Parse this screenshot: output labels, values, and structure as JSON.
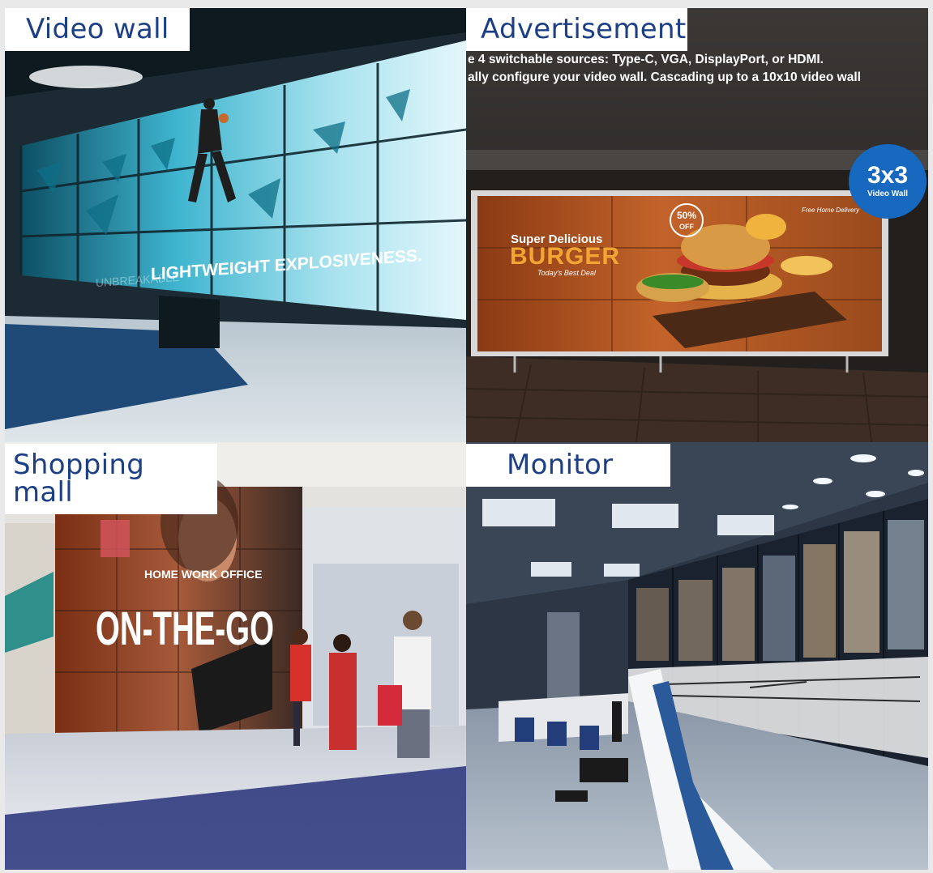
{
  "panels": {
    "video_wall": {
      "title": "Video wall",
      "wall_text": "LIGHTWEIGHT EXPLOSIVENESS.",
      "wall_text_faded": "UNBREAKABLE"
    },
    "advertisement": {
      "title": "Advertisement",
      "caption_line1": "e 4 switchable sources: Type-C, VGA, DisplayPort, or HDMI.",
      "caption_line2": "ally configure your video wall. Cascading up to a 10x10 video wall",
      "badge_big": "3x3",
      "badge_small": "Video Wall",
      "ad_super": "Super Delicious",
      "ad_main": "BURGER",
      "ad_sub": "Today's Best Deal",
      "discount_pct": "50%",
      "discount_off": "OFF",
      "delivery": "Free Home Delivery"
    },
    "shopping_mall": {
      "title": "Shopping mall",
      "ad_small": "HOME WORK OFFICE",
      "ad_big": "ON-THE-GO"
    },
    "monitor": {
      "title": "Monitor"
    }
  },
  "colors": {
    "title_text": "#1d3f86",
    "title_background": "#ffffff",
    "badge": "#1768bf"
  }
}
